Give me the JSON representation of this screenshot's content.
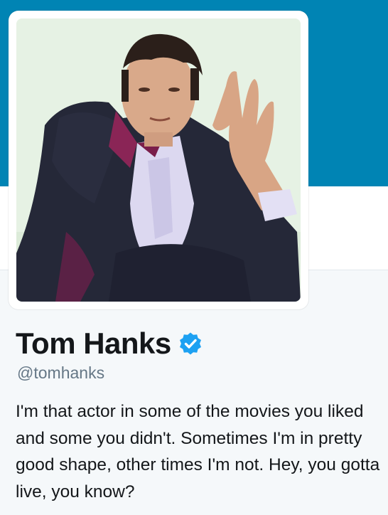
{
  "profile": {
    "name": "Tom Hanks",
    "handle": "@tomhanks",
    "verified": true,
    "bio": "I'm that actor in some of the movies you liked and some you didn't. Sometimes I'm in pretty good shape, other times I'm not. Hey, you gotta live, you know?"
  },
  "icons": {
    "verified": "verified-badge-icon"
  },
  "colors": {
    "header_background": "#0084b4",
    "page_background": "#f5f8fa",
    "verified_badge": "#1da1f2",
    "handle_text": "#657786",
    "name_text": "#14171a"
  }
}
